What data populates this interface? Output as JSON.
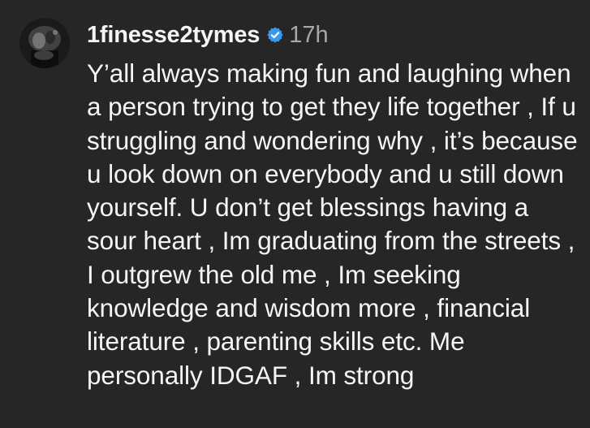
{
  "comment": {
    "username": "1finesse2tymes",
    "verified_icon": "verified-badge-icon",
    "verified_color": "#3897f0",
    "timestamp": "17h",
    "text": "Y’all always making fun and laughing when a person trying to get they life together , If u struggling and wondering why , it’s because u look down on everybody and u still down yourself. U don’t get blessings having a sour heart , Im graduating from the streets , I outgrew the old me , Im seeking knowledge and wisdom more , financial literature , parenting skills etc. Me personally IDGAF , Im strong"
  },
  "colors": {
    "background": "#262626",
    "primary_text": "#f5f5f5",
    "secondary_text": "#a8a8a8"
  }
}
